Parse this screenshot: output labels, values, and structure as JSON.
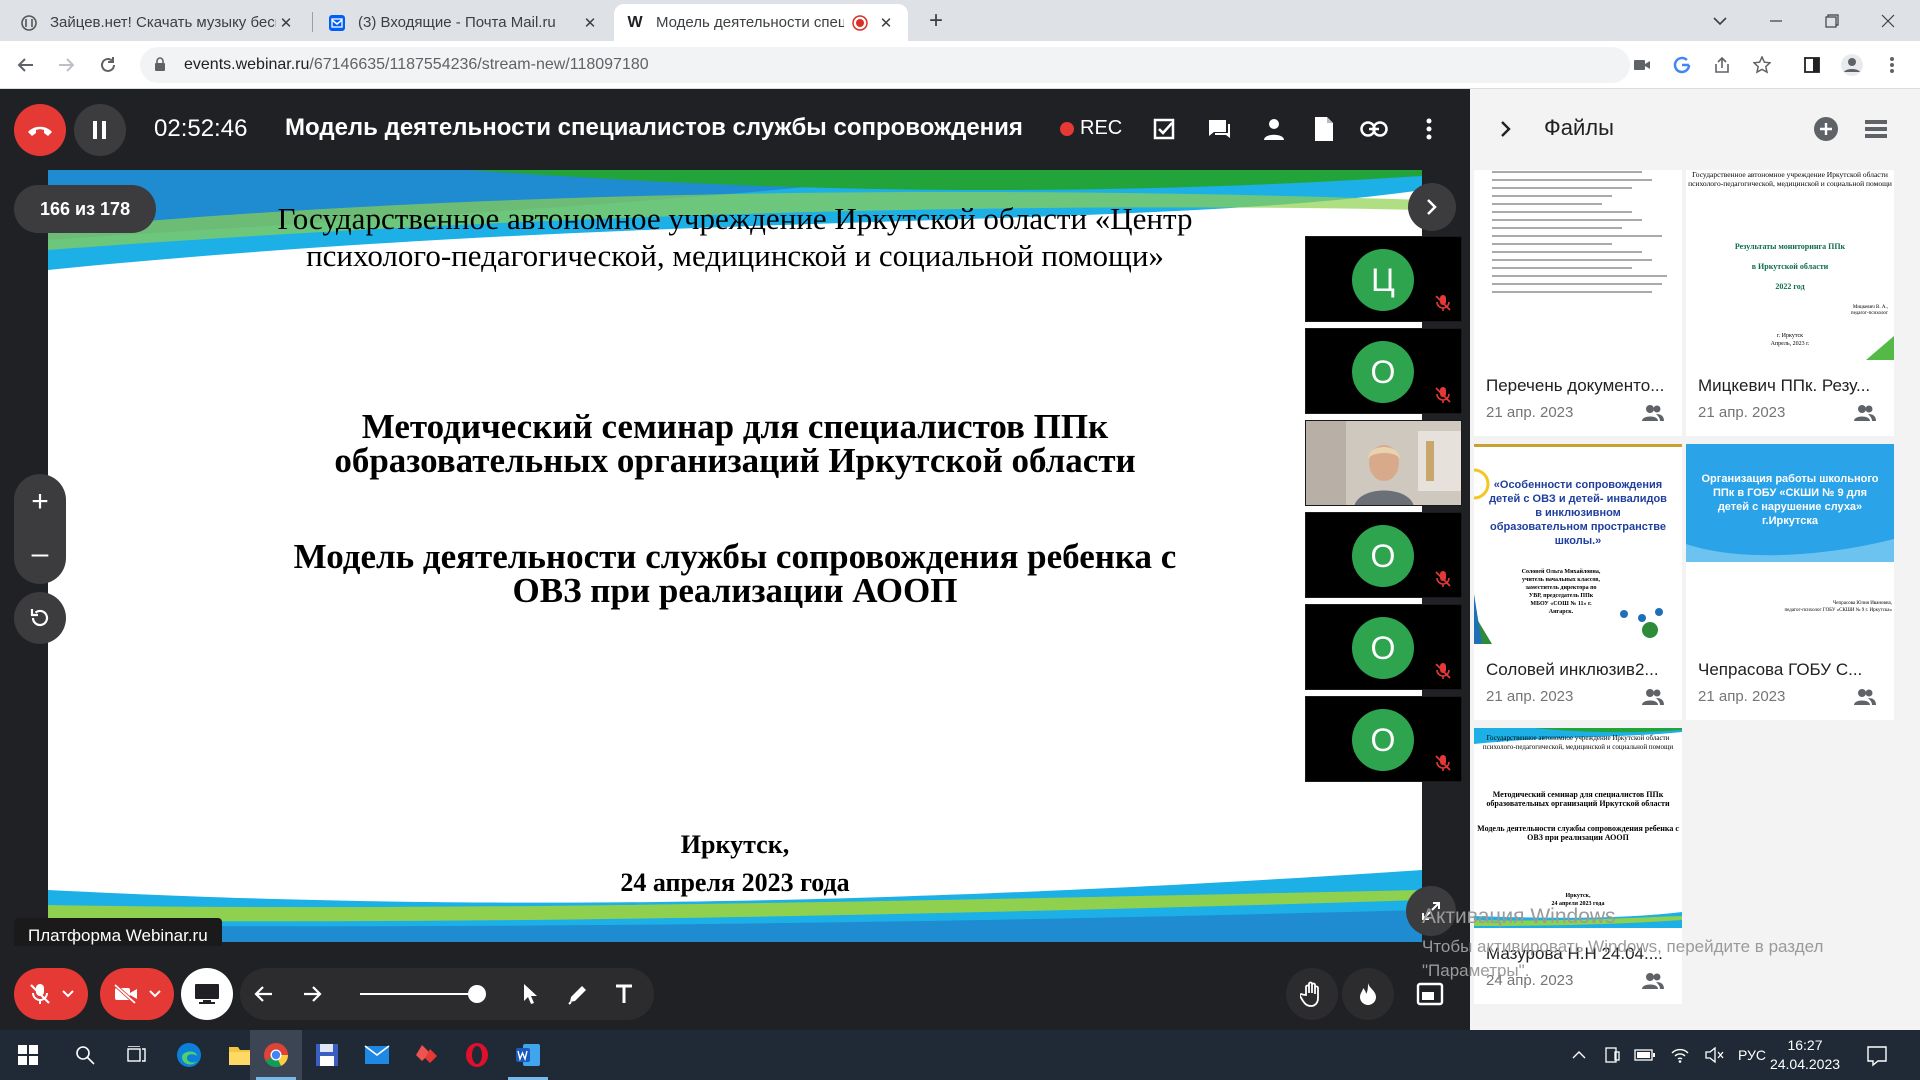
{
  "browser": {
    "tabs": [
      {
        "title": "Зайцев.нет! Скачать музыку бесплатно",
        "favicon": "zaycev-icon"
      },
      {
        "title": "(3) Входящие - Почта Mail.ru",
        "favicon": "mail-icon"
      },
      {
        "title": "Модель деятельности специалистов службы сопровождения",
        "favicon": "webinar-w-icon",
        "active": true
      }
    ],
    "new_tab": "+",
    "url_host": "events.webinar.ru",
    "url_path": "/67146635/1187554236/stream-new/118097180"
  },
  "webinar": {
    "timer": "02:52:46",
    "title": "Модель деятельности специалистов службы сопровождения",
    "rec_label": "REC",
    "page_counter": "166 из 178",
    "platform_label": "Платформа Webinar.ru",
    "zoom_in": "+",
    "zoom_out": "–"
  },
  "slide": {
    "org_line1": "Государственное автономное учреждение Иркутской области «Центр",
    "org_line2": "психолого-педагогической, медицинской и социальной помощи»",
    "seminar_line1": "Методический семинар для специалистов ППк",
    "seminar_line2": "образовательных организаций Иркутской области",
    "model_line1": "Модель деятельности службы сопровождения ребенка с",
    "model_line2": "ОВЗ при реализации АООП",
    "city": "Иркутск,",
    "date": "24 апреля 2023 года"
  },
  "participants": [
    {
      "initial": "Ц",
      "muted": true
    },
    {
      "initial": "О",
      "muted": true
    },
    {
      "initial": "",
      "video": true
    },
    {
      "initial": "О",
      "muted": true
    },
    {
      "initial": "О",
      "muted": true
    },
    {
      "initial": "О",
      "muted": true
    }
  ],
  "files_panel": {
    "title": "Файлы",
    "files": [
      {
        "name": "Перечень документо...",
        "date": "21 апр. 2023"
      },
      {
        "name": "Мицкевич ППк. Резу...",
        "date": "21 апр. 2023",
        "thumb": {
          "l1": "Государственное автономное учреждение Иркутской области",
          "l2": "психолого-педагогической, медицинской и социальной помощи",
          "t1": "Результаты мониторинга ППк",
          "t2": "в Иркутской области",
          "t3": "2022 год",
          "a1": "Мицкевич В. А.,",
          "a2": "педагог-психолог",
          "c1": "г. Иркутск",
          "c2": "Апрель, 2023 г."
        }
      },
      {
        "name": "Соловей инклюзив2...",
        "date": "21 апр. 2023",
        "thumb": {
          "t1": "«Особенности сопровождения",
          "t2": "детей с ОВЗ и детей- инвалидов",
          "t3": "в инклюзивном",
          "t4": "образовательном пространстве",
          "t5": "школы.»",
          "a1": "Соловей Ольга Михайловна,",
          "a2": "учитель начальных классов,",
          "a3": "заместитель директора по",
          "a4": "УВР, председатель ППк",
          "a5": "МБОУ «СОШ № 11» г.",
          "a6": "Ангарск."
        }
      },
      {
        "name": "Чепрасова ГОБУ С...",
        "date": "21 апр. 2023",
        "thumb": {
          "t1": "Организация работы школьного",
          "t2": "ППк в ГОБУ «СКШИ № 9 для",
          "t3": "детей с нарушение слуха»",
          "t4": "г.Иркутска",
          "a1": "Чепрасова Юлия Ивановна,",
          "a2": "педагог-психолог ГОБУ «СКШИ № 9 г. Иркутска»"
        }
      },
      {
        "name": "Мазурова Н.Н 24.04....",
        "date": "24 апр. 2023",
        "thumb": {
          "l1": "Государственное автономное учреждение Иркутской области",
          "l2": "психолого-педагогической, медицинской и социальной помощи",
          "s1": "Методический семинар для специалистов ППк",
          "s2": "образовательных организаций Иркутской области",
          "m1": "Модель деятельности службы сопровождения ребенка с",
          "m2": "ОВЗ при реализации АООП",
          "c1": "Иркутск,",
          "c2": "24 апреля 2023 года"
        }
      }
    ]
  },
  "watermark": {
    "line1": "Активация Windows",
    "line2": "Чтобы активировать Windows, перейдите в раздел",
    "line3": "\"Параметры\"."
  },
  "taskbar": {
    "lang": "РУС",
    "time": "16:27",
    "date": "24.04.2023"
  },
  "colors": {
    "accent_green": "#2ea44f",
    "danger_red": "#e53935",
    "dark_bg": "#202124"
  }
}
